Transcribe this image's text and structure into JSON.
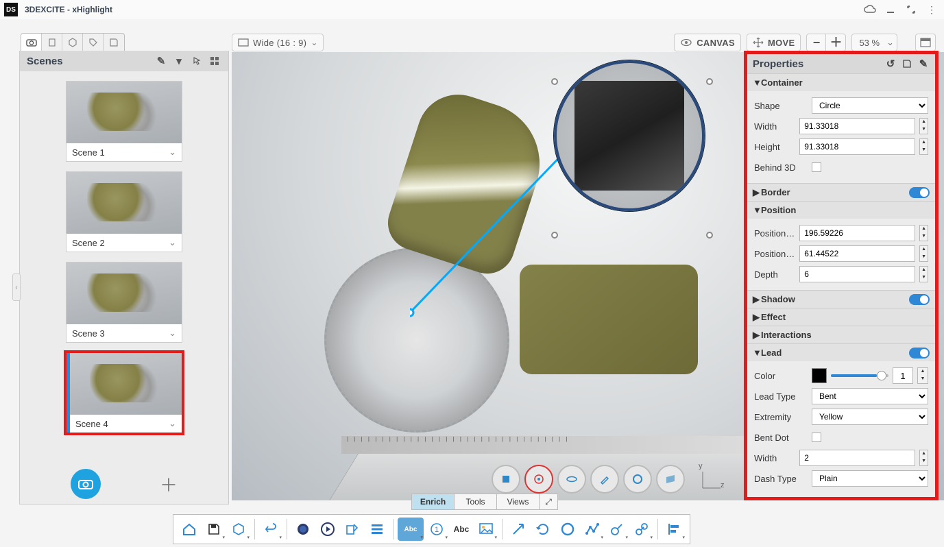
{
  "app": {
    "title": "3DEXCITE - xHighlight"
  },
  "scenes_panel": {
    "title": "Scenes",
    "items": [
      {
        "label": "Scene 1"
      },
      {
        "label": "Scene 2"
      },
      {
        "label": "Scene 3"
      },
      {
        "label": "Scene 4"
      }
    ],
    "selected_index": 3
  },
  "viewport_bar": {
    "aspect_label": "Wide (16 : 9)",
    "canvas_label": "CANVAS",
    "move_label": "MOVE",
    "zoom_pct": "53 %"
  },
  "mode_tabs": {
    "tabs": [
      "Enrich",
      "Tools",
      "Views"
    ],
    "active_index": 0
  },
  "properties": {
    "title": "Properties",
    "container": {
      "header": "Container",
      "shape_label": "Shape",
      "shape_value": "Circle",
      "width_label": "Width",
      "width_value": "91.33018",
      "height_label": "Height",
      "height_value": "91.33018",
      "behind3d_label": "Behind 3D"
    },
    "border": {
      "header": "Border"
    },
    "position": {
      "header": "Position",
      "x_label": "Position X ...",
      "x_value": "196.59226",
      "y_label": "Position Y ...",
      "y_value": "61.44522",
      "depth_label": "Depth",
      "depth_value": "6"
    },
    "shadow": {
      "header": "Shadow"
    },
    "effect": {
      "header": "Effect"
    },
    "interactions": {
      "header": "Interactions"
    },
    "lead": {
      "header": "Lead",
      "color_label": "Color",
      "color_value": "#000000",
      "opacity_value": "1",
      "leadtype_label": "Lead Type",
      "leadtype_value": "Bent",
      "extremity_label": "Extremity",
      "extremity_value": "Yellow",
      "bentdot_label": "Bent Dot",
      "width_label": "Width",
      "width_value": "2",
      "dash_label": "Dash Type",
      "dash_value": "Plain"
    }
  },
  "axis_gizmo": {
    "y": "y",
    "z": "z"
  },
  "bottom_tool_names": [
    "home",
    "save",
    "package",
    "undo",
    "render",
    "play",
    "export",
    "list",
    "abc-badge",
    "number-one",
    "abc-text",
    "picture",
    "arrow",
    "rotate",
    "circle",
    "polyline",
    "annot",
    "link",
    "align"
  ]
}
